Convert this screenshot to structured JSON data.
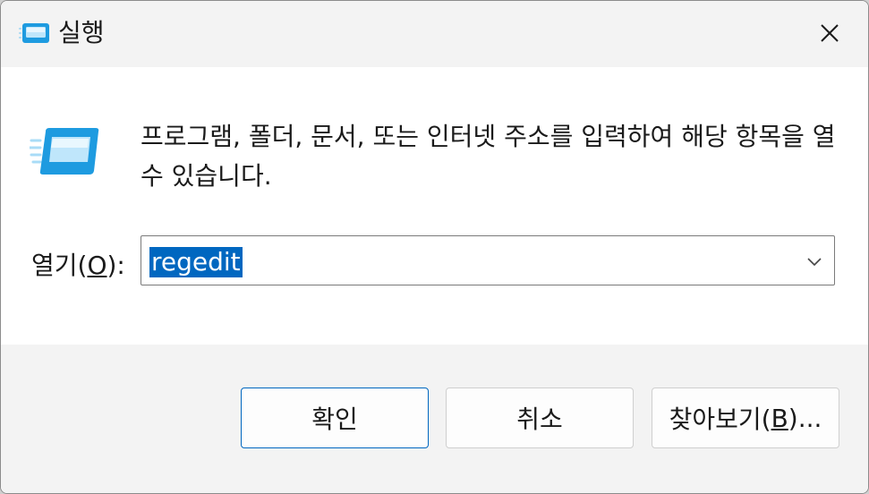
{
  "window": {
    "title": "실행",
    "icon": "run-icon",
    "close_icon": "close-icon"
  },
  "dialog": {
    "description": "프로그램, 폴더, 문서, 또는 인터넷 주소를 입력하여 해당 항목을 열 수 있습니다.",
    "open_label_prefix": "열기(",
    "open_label_access_key": "O",
    "open_label_suffix": "):",
    "input_value": "regedit",
    "dropdown_icon": "chevron-down-icon"
  },
  "buttons": {
    "ok_label": "확인",
    "cancel_label": "취소",
    "browse_label_prefix": "찾아보기(",
    "browse_access_key": "B",
    "browse_label_suffix": ")..."
  },
  "colors": {
    "selection": "#0067c0",
    "primary_border": "#0067c0",
    "titlebar": "#f3f3f3",
    "footer": "#f3f3f3"
  }
}
